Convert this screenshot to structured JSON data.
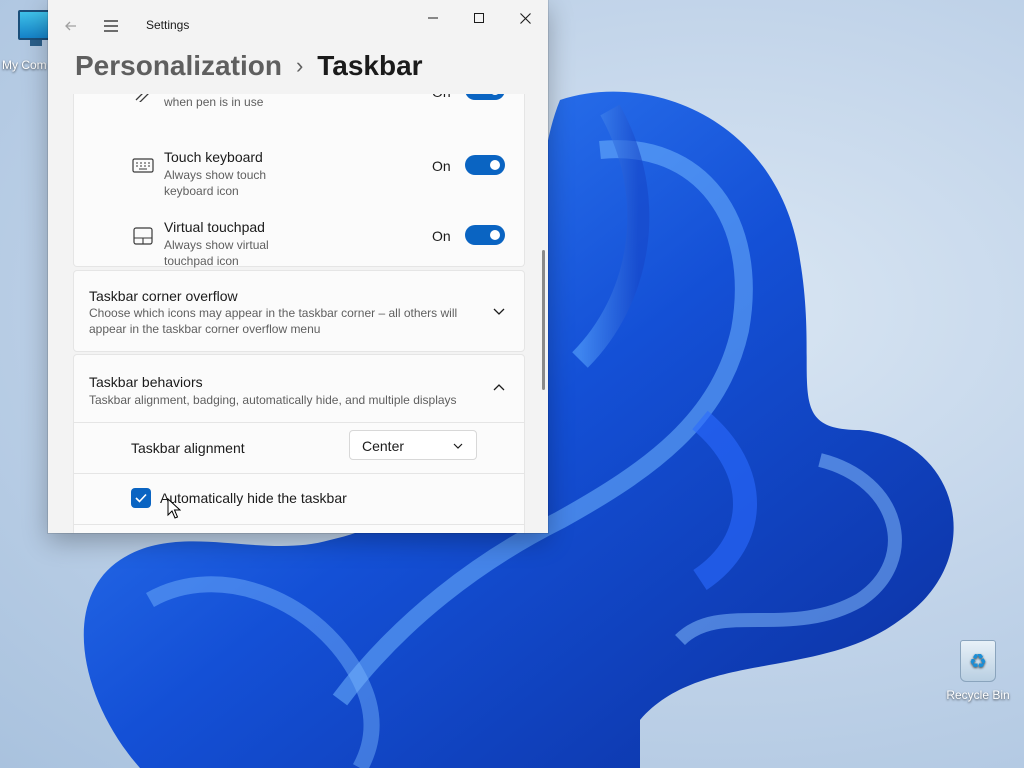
{
  "desktop": {
    "computer_icon_label": "My Com",
    "recycle_bin_label": "Recycle Bin"
  },
  "window": {
    "app_title": "Settings",
    "breadcrumb": {
      "parent": "Personalization",
      "separator": "›",
      "current": "Taskbar"
    },
    "controls": {
      "minimize": "minimize-icon",
      "maximize": "maximize-icon",
      "close": "close-icon"
    }
  },
  "taskbar_icons": [
    {
      "title": "",
      "desc": "Show pen menu icon when pen is in use",
      "state": "On",
      "icon": "pen-icon"
    },
    {
      "title": "Touch keyboard",
      "desc": "Always show touch keyboard icon",
      "state": "On",
      "icon": "keyboard-icon"
    },
    {
      "title": "Virtual touchpad",
      "desc": "Always show virtual touchpad icon",
      "state": "On",
      "icon": "touchpad-icon"
    }
  ],
  "corner_overflow": {
    "title": "Taskbar corner overflow",
    "desc": "Choose which icons may appear in the taskbar corner – all others will appear in the taskbar corner overflow menu",
    "expanded": false
  },
  "behaviors": {
    "title": "Taskbar behaviors",
    "desc": "Taskbar alignment, badging, automatically hide, and multiple displays",
    "expanded": true,
    "alignment_label": "Taskbar alignment",
    "alignment_value": "Center",
    "autohide_label": "Automatically hide the taskbar",
    "autohide_checked": true
  },
  "colors": {
    "accent": "#0a64c2",
    "window_bg": "#f3f3f3",
    "card_bg": "#fbfbfb"
  }
}
